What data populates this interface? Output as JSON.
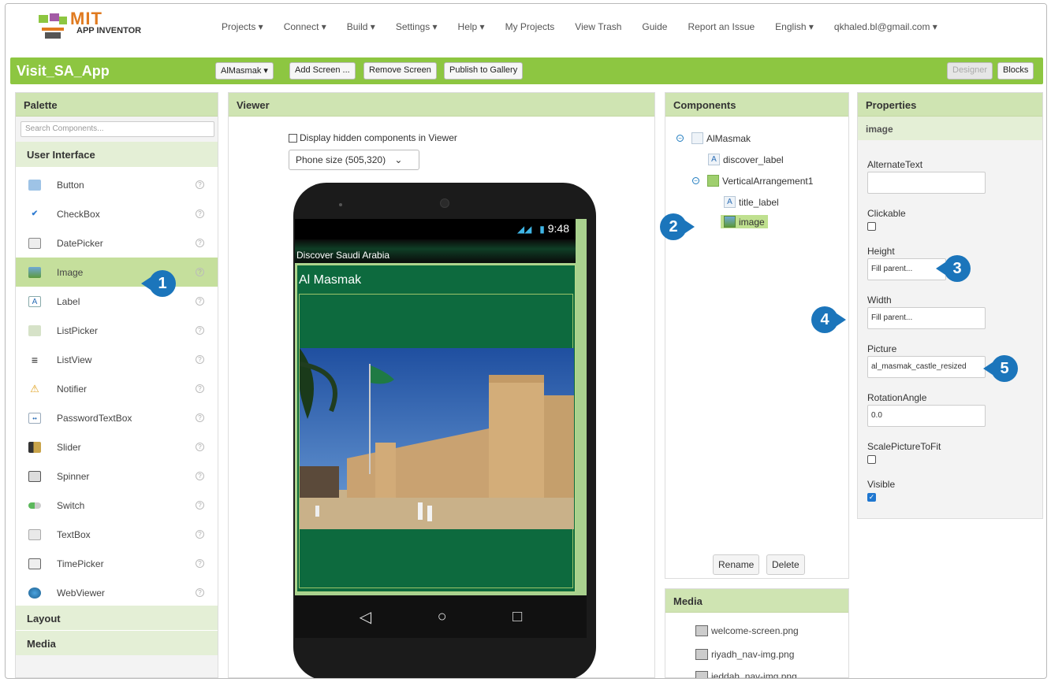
{
  "topnav": {
    "logo_mit": "MIT",
    "logo_app": "APP INVENTOR",
    "menu": [
      "Projects ▾",
      "Connect ▾",
      "Build ▾",
      "Settings ▾",
      "Help ▾",
      "My Projects",
      "View Trash",
      "Guide",
      "Report an Issue",
      "English ▾",
      "qkhaled.bl@gmail.com ▾"
    ]
  },
  "titlebar": {
    "app_name": "Visit_SA_App",
    "screen_select": "AlMasmak ▾",
    "add_screen": "Add Screen ...",
    "remove_screen": "Remove Screen",
    "publish": "Publish to Gallery",
    "designer": "Designer",
    "blocks": "Blocks"
  },
  "palette": {
    "title": "Palette",
    "search_placeholder": "Search Components...",
    "section": "User Interface",
    "items": [
      {
        "label": "Button",
        "icon": "button-icon"
      },
      {
        "label": "CheckBox",
        "icon": "checkbox-icon"
      },
      {
        "label": "DatePicker",
        "icon": "calendar-icon"
      },
      {
        "label": "Image",
        "icon": "image-icon"
      },
      {
        "label": "Label",
        "icon": "label-icon"
      },
      {
        "label": "ListPicker",
        "icon": "list-picker-icon"
      },
      {
        "label": "ListView",
        "icon": "list-view-icon"
      },
      {
        "label": "Notifier",
        "icon": "warning-icon"
      },
      {
        "label": "PasswordTextBox",
        "icon": "password-icon"
      },
      {
        "label": "Slider",
        "icon": "slider-icon"
      },
      {
        "label": "Spinner",
        "icon": "spinner-icon"
      },
      {
        "label": "Switch",
        "icon": "switch-icon"
      },
      {
        "label": "TextBox",
        "icon": "textbox-icon"
      },
      {
        "label": "TimePicker",
        "icon": "clock-icon"
      },
      {
        "label": "WebViewer",
        "icon": "globe-icon"
      }
    ],
    "layout": "Layout",
    "media": "Media",
    "help_glyph": "?"
  },
  "viewer": {
    "title": "Viewer",
    "hidden_label": "Display hidden components in Viewer",
    "size_select": "Phone size (505,320)",
    "time": "9:48",
    "screen_title": "Discover Saudi Arabia",
    "heading": "Al Masmak",
    "nav": [
      "◁",
      "○",
      "□"
    ]
  },
  "components": {
    "title": "Components",
    "tree": {
      "root": "AlMasmak",
      "discover": "discover_label",
      "varr": "VerticalArrangement1",
      "title_label": "title_label",
      "image": "image"
    },
    "rename": "Rename",
    "delete": "Delete"
  },
  "media": {
    "title": "Media",
    "files": [
      "welcome-screen.png",
      "riyadh_nav-img.png",
      "jeddah_nav-img.png"
    ]
  },
  "properties": {
    "title": "Properties",
    "component": "image",
    "alt_text_label": "AlternateText",
    "alt_text_value": "",
    "clickable_label": "Clickable",
    "clickable": false,
    "height_label": "Height",
    "height_value": "Fill parent...",
    "width_label": "Width",
    "width_value": "Fill parent...",
    "picture_label": "Picture",
    "picture_value": "al_masmak_castle_resized",
    "rotation_label": "RotationAngle",
    "rotation_value": "0.0",
    "scale_label": "ScalePictureToFit",
    "scale": false,
    "visible_label": "Visible",
    "visible": true
  },
  "callouts": [
    "1",
    "2",
    "3",
    "4",
    "5"
  ],
  "colors": {
    "accent_green": "#8dc641",
    "panel_header": "#cfe4b2",
    "callout_blue": "#1b75bb",
    "screen_green": "#0d6a3e"
  }
}
